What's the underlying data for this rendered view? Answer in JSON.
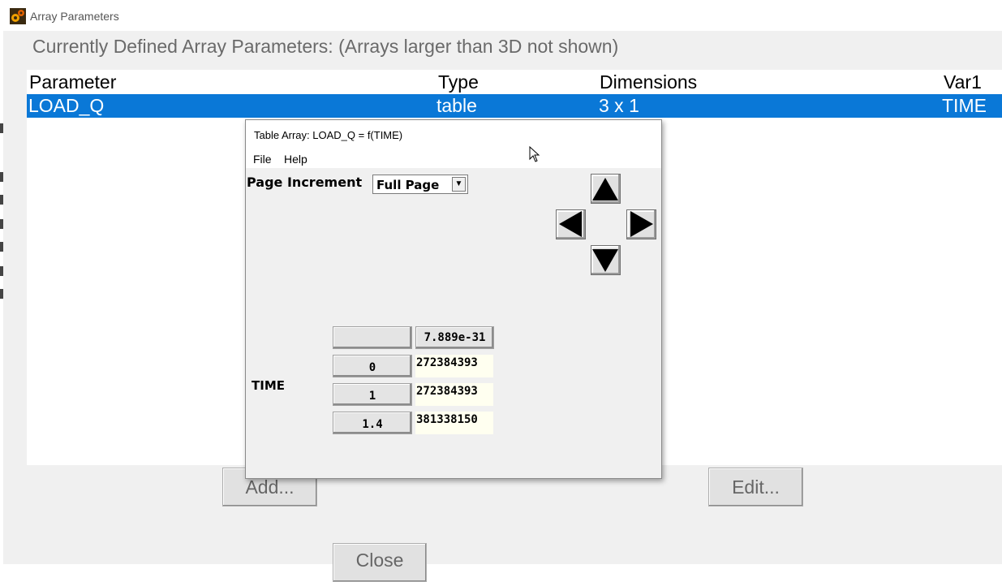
{
  "window": {
    "title": "Array Parameters"
  },
  "heading": "Currently Defined Array Parameters: (Arrays larger than 3D not shown)",
  "columns": {
    "parameter": "Parameter",
    "type": "Type",
    "dimensions": "Dimensions",
    "var1": "Var1"
  },
  "rows": [
    {
      "parameter": "LOAD_Q",
      "type": "table",
      "dimensions": "3 x 1",
      "var1": "TIME",
      "selected": true
    }
  ],
  "buttons": {
    "add": "Add...",
    "edit": "Edit...",
    "close": "Close"
  },
  "dialog": {
    "title": "Table Array: LOAD_Q = f(TIME)",
    "menu": [
      "File",
      "Help"
    ],
    "page_increment_label": "Page Increment",
    "page_increment_value": "Full Page",
    "row_variable_label": "TIME",
    "column_header_value": "7.889e-31",
    "rows": [
      {
        "key": "0",
        "value": "272384393"
      },
      {
        "key": "1",
        "value": "272384393"
      },
      {
        "key": "1.4",
        "value": "381338150"
      }
    ]
  },
  "colors": {
    "selection": "#0a78d7",
    "cell_background": "#fffff0",
    "dialog_background": "#f0f0f0"
  },
  "icons": [
    "app-gears-icon",
    "arrow-up-icon",
    "arrow-left-icon",
    "arrow-right-icon",
    "arrow-down-icon",
    "dropdown-chevron-icon",
    "mouse-cursor-icon"
  ]
}
